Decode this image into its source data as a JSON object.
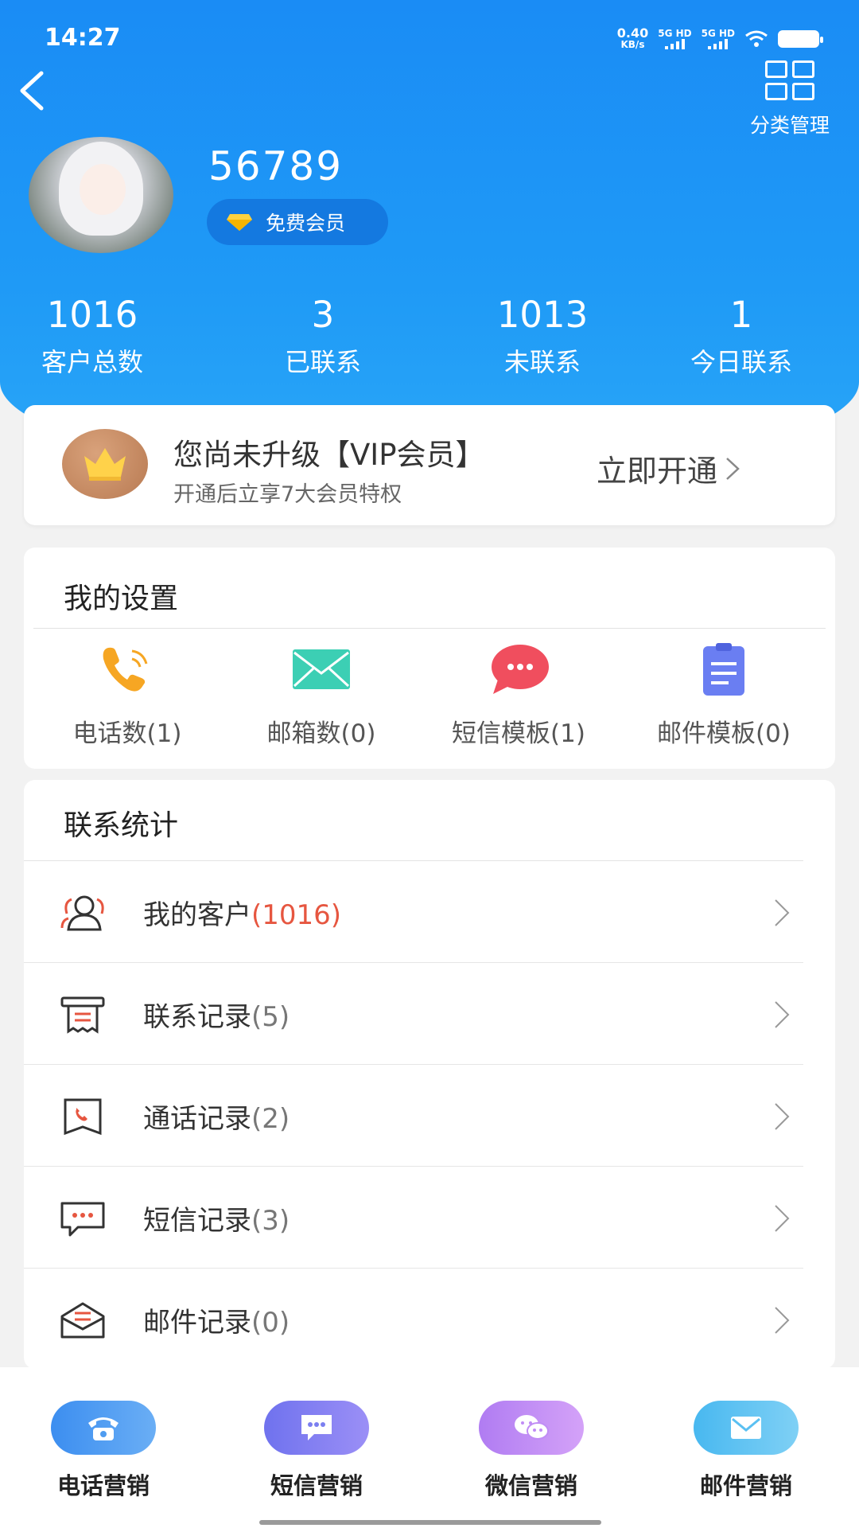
{
  "status_bar": {
    "time": "14:27",
    "net_speed_value": "0.40",
    "net_speed_unit": "KB/s",
    "sim1": "5G HD",
    "sim2": "5G HD",
    "battery_icon": "battery-icon",
    "wifi_icon": "wifi-icon"
  },
  "header": {
    "back_icon": "back-arrow-icon",
    "category_manage_label": "分类管理",
    "category_manage_icon": "grid-icon"
  },
  "profile": {
    "username": "56789",
    "member_label": "免费会员",
    "member_icon": "diamond-icon"
  },
  "stats": [
    {
      "value": "1016",
      "label": "客户总数"
    },
    {
      "value": "3",
      "label": "已联系"
    },
    {
      "value": "1013",
      "label": "未联系"
    },
    {
      "value": "1",
      "label": "今日联系"
    }
  ],
  "vip": {
    "title": "您尚未升级【VIP会员】",
    "subtitle": "开通后立享7大会员特权",
    "cta": "立即开通",
    "icon": "crown-icon"
  },
  "settings": {
    "title": "我的设置",
    "items": [
      {
        "label": "电话数(1)",
        "icon": "phone-icon"
      },
      {
        "label": "邮箱数(0)",
        "icon": "mail-icon"
      },
      {
        "label": "短信模板(1)",
        "icon": "sms-bubble-icon"
      },
      {
        "label": "邮件模板(0)",
        "icon": "clipboard-icon"
      }
    ]
  },
  "contact_stats": {
    "title": "联系统计",
    "rows": [
      {
        "label": "我的客户",
        "count": "(1016)",
        "icon": "customers-icon"
      },
      {
        "label": "联系记录",
        "count": "(5)",
        "icon": "receipt-icon"
      },
      {
        "label": "通话记录",
        "count": "(2)",
        "icon": "call-log-icon"
      },
      {
        "label": "短信记录",
        "count": "(3)",
        "icon": "message-icon"
      },
      {
        "label": "邮件记录",
        "count": "(0)",
        "icon": "envelope-icon"
      }
    ]
  },
  "bottom_tabs": [
    {
      "label": "电话营销",
      "icon": "telephone-icon"
    },
    {
      "label": "短信营销",
      "icon": "chat-icon"
    },
    {
      "label": "微信营销",
      "icon": "wechat-icon"
    },
    {
      "label": "邮件营销",
      "icon": "email-icon"
    }
  ],
  "colors": {
    "header_blue": "#1a8cf5",
    "accent_red": "#e65640",
    "tab_phone": "#4f9cf0",
    "tab_sms": "#7b7ff0",
    "tab_wechat": "#c08cf5",
    "tab_email": "#5ac0f2"
  }
}
